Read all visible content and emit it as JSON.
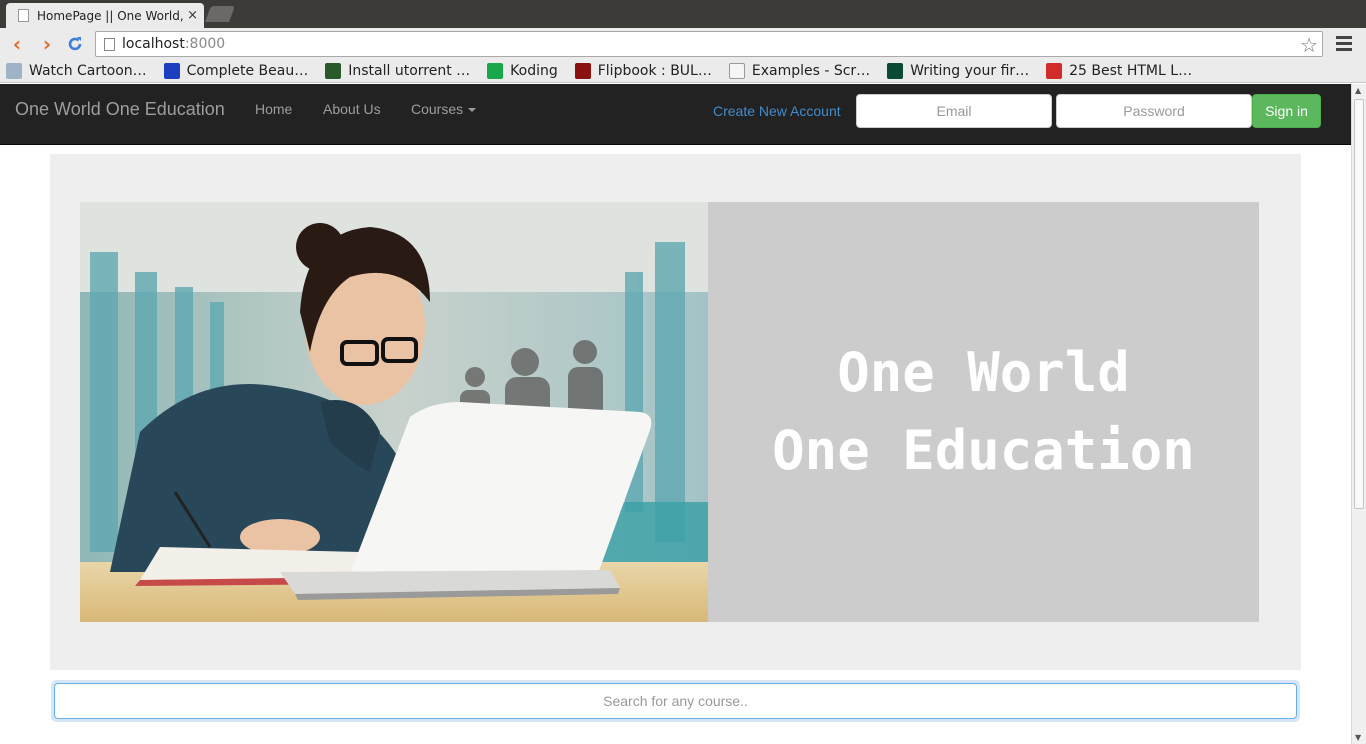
{
  "browser": {
    "tab_title": "HomePage || One World,O",
    "close_glyph": "×",
    "url_host": "localhost",
    "url_port": ":8000",
    "bookmarks": [
      {
        "label": "Watch Cartoon…",
        "icon": "cartoon-icon",
        "color": "#9fb3c8"
      },
      {
        "label": "Complete Beau…",
        "icon": "beau-icon",
        "color": "#1c3fbf"
      },
      {
        "label": "Install utorrent …",
        "icon": "utorrent-icon",
        "color": "#2a5a2a"
      },
      {
        "label": "Koding",
        "icon": "koding-icon",
        "color": "#1aa64a"
      },
      {
        "label": "Flipbook : BUL…",
        "icon": "flipbook-icon",
        "color": "#8b1010"
      },
      {
        "label": "Examples - Scr…",
        "icon": "page-icon",
        "color": "#f5f5f5"
      },
      {
        "label": "Writing your fir…",
        "icon": "django-icon",
        "color": "#0c4b33"
      },
      {
        "label": "25 Best HTML L…",
        "icon": "html-icon",
        "color": "#d22b2b"
      }
    ]
  },
  "navbar": {
    "brand": "One World One Education",
    "links": {
      "home": "Home",
      "about": "About Us",
      "courses": "Courses"
    },
    "create_account": "Create New Account",
    "email_placeholder": "Email",
    "password_placeholder": "Password",
    "signin_label": "Sign in"
  },
  "hero": {
    "line1": "One World",
    "line2": "One Education"
  },
  "search": {
    "placeholder": "Search for any course.."
  },
  "colors": {
    "navbar_bg": "#222222",
    "link_blue": "#428bca",
    "signin_green": "#5cb85c",
    "jumbotron_bg": "#eeeeee",
    "banner_bg": "#cccccc"
  }
}
